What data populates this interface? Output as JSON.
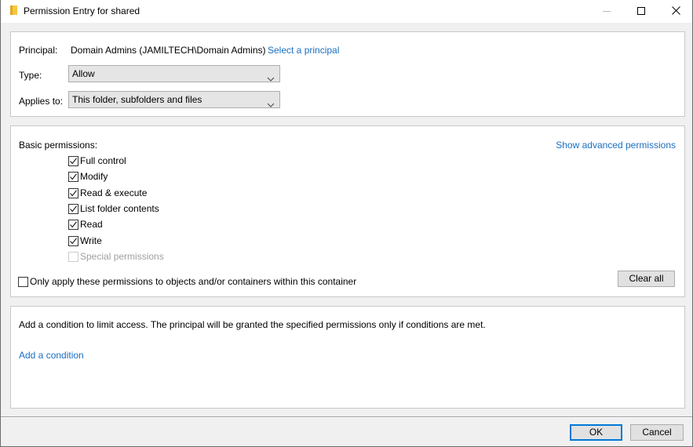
{
  "window": {
    "title": "Permission Entry for shared",
    "icon": "folder-icon",
    "controls": {
      "minimize": "minimize-icon",
      "maximize": "maximize-icon",
      "close": "close-icon"
    }
  },
  "principal_section": {
    "principal_label": "Principal:",
    "principal_value": "Domain Admins (JAMILTECH\\Domain Admins)",
    "select_principal_link": "Select a principal",
    "type_label": "Type:",
    "type_value": "Allow",
    "applies_to_label": "Applies to:",
    "applies_to_value": "This folder, subfolders and files"
  },
  "permissions_section": {
    "heading": "Basic permissions:",
    "show_advanced_link": "Show advanced permissions",
    "permissions": [
      {
        "label": "Full control",
        "checked": true,
        "enabled": true
      },
      {
        "label": "Modify",
        "checked": true,
        "enabled": true
      },
      {
        "label": "Read & execute",
        "checked": true,
        "enabled": true
      },
      {
        "label": "List folder contents",
        "checked": true,
        "enabled": true
      },
      {
        "label": "Read",
        "checked": true,
        "enabled": true
      },
      {
        "label": "Write",
        "checked": true,
        "enabled": true
      },
      {
        "label": "Special permissions",
        "checked": false,
        "enabled": false
      }
    ],
    "only_apply_label": "Only apply these permissions to objects and/or containers within this container",
    "only_apply_checked": false,
    "clear_all_label": "Clear all"
  },
  "condition_section": {
    "description": "Add a condition to limit access. The principal will be granted the specified permissions only if conditions are met.",
    "add_condition_link": "Add a condition"
  },
  "footer": {
    "ok_label": "OK",
    "cancel_label": "Cancel"
  },
  "colors": {
    "link": "#1a6fc2",
    "default_button_border": "#0078d7",
    "folder_icon": "#f5c842"
  }
}
